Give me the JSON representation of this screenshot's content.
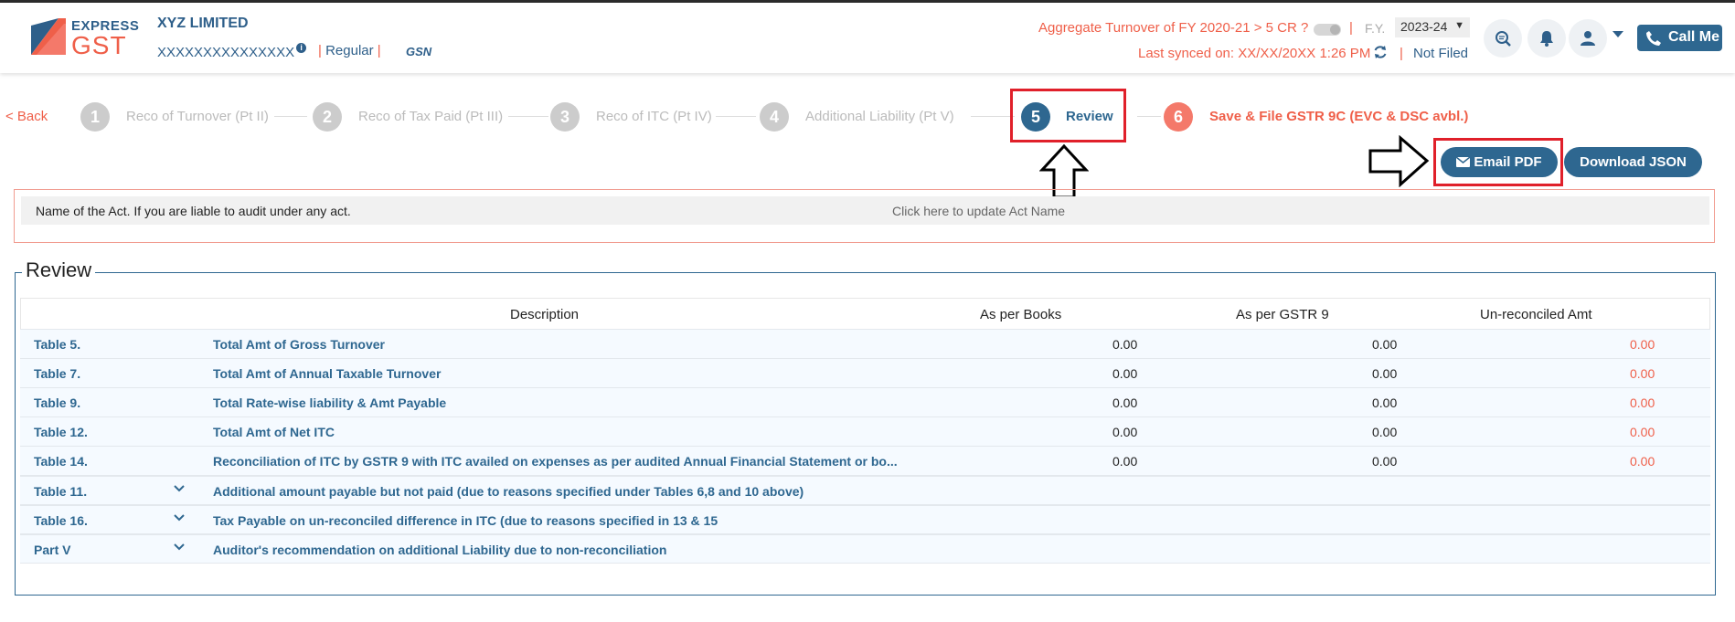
{
  "brand": {
    "express": "EXPRESS",
    "gst": "GST",
    "gstn_mark": "GSN",
    "colors": {
      "primary": "#2e6790",
      "accent": "#ef5f49",
      "highlight": "#e0202a"
    }
  },
  "header": {
    "company": "XYZ LIMITED",
    "gstin": "XXXXXXXXXXXXXXX",
    "info_icon": "i",
    "separator": "|",
    "taxpayer_type": "Regular",
    "aggregate_turnover": "Aggregate Turnover of FY 2020-21 > 5 CR ?",
    "fy_label": "F.Y.",
    "fy_value": "2023-24",
    "last_synced": "Last synced on: XX/XX/20XX 1:26 PM",
    "filing_status": "Not Filed",
    "call_me": "Call Me",
    "icons": [
      "search-doc-icon",
      "bell-icon",
      "user-icon",
      "phone-icon",
      "sync-icon"
    ]
  },
  "stepper": {
    "back": "< Back",
    "steps": [
      {
        "num": "1",
        "label": "Reco of Turnover (Pt II)"
      },
      {
        "num": "2",
        "label": "Reco of Tax Paid (Pt III)"
      },
      {
        "num": "3",
        "label": "Reco of ITC (Pt IV)"
      },
      {
        "num": "4",
        "label": "Additional Liability (Pt V)"
      },
      {
        "num": "5",
        "label": "Review",
        "state": "active"
      },
      {
        "num": "6",
        "label": "Save & File GSTR 9C (EVC & DSC avbl.)",
        "state": "final"
      }
    ]
  },
  "actions": {
    "email_pdf": "Email PDF",
    "download_json": "Download JSON"
  },
  "act": {
    "label": "Name of the Act. If you are liable to audit under any act.",
    "link": "Click here to update Act Name"
  },
  "review": {
    "title": "Review",
    "columns": [
      "Description",
      "As per Books",
      "As per GSTR 9",
      "Un-reconciled Amt"
    ],
    "rows": [
      {
        "table": "Table 5.",
        "desc": "Total Amt of Gross Turnover",
        "books": "0.00",
        "gstr9": "0.00",
        "unrec": "0.00"
      },
      {
        "table": "Table 7.",
        "desc": "Total Amt of Annual Taxable Turnover",
        "books": "0.00",
        "gstr9": "0.00",
        "unrec": "0.00"
      },
      {
        "table": "Table 9.",
        "desc": "Total Rate-wise liability & Amt Payable",
        "books": "0.00",
        "gstr9": "0.00",
        "unrec": "0.00"
      },
      {
        "table": "Table 12.",
        "desc": "Total Amt of Net ITC",
        "books": "0.00",
        "gstr9": "0.00",
        "unrec": "0.00"
      },
      {
        "table": "Table 14.",
        "desc": "Reconciliation of ITC by GSTR 9 with ITC availed on expenses as per audited Annual Financial Statement or bo...",
        "books": "0.00",
        "gstr9": "0.00",
        "unrec": "0.00"
      }
    ],
    "expandable_rows": [
      {
        "table": "Table 11.",
        "desc": "Additional amount payable but not paid (due to reasons specified under Tables 6,8 and 10 above)"
      },
      {
        "table": "Table 16.",
        "desc": "Tax Payable on un-reconciled difference in ITC (due to reasons specified in 13 & 15"
      },
      {
        "table": "Part V",
        "desc": "Auditor's recommendation on additional Liability due to non-reconciliation"
      }
    ]
  }
}
